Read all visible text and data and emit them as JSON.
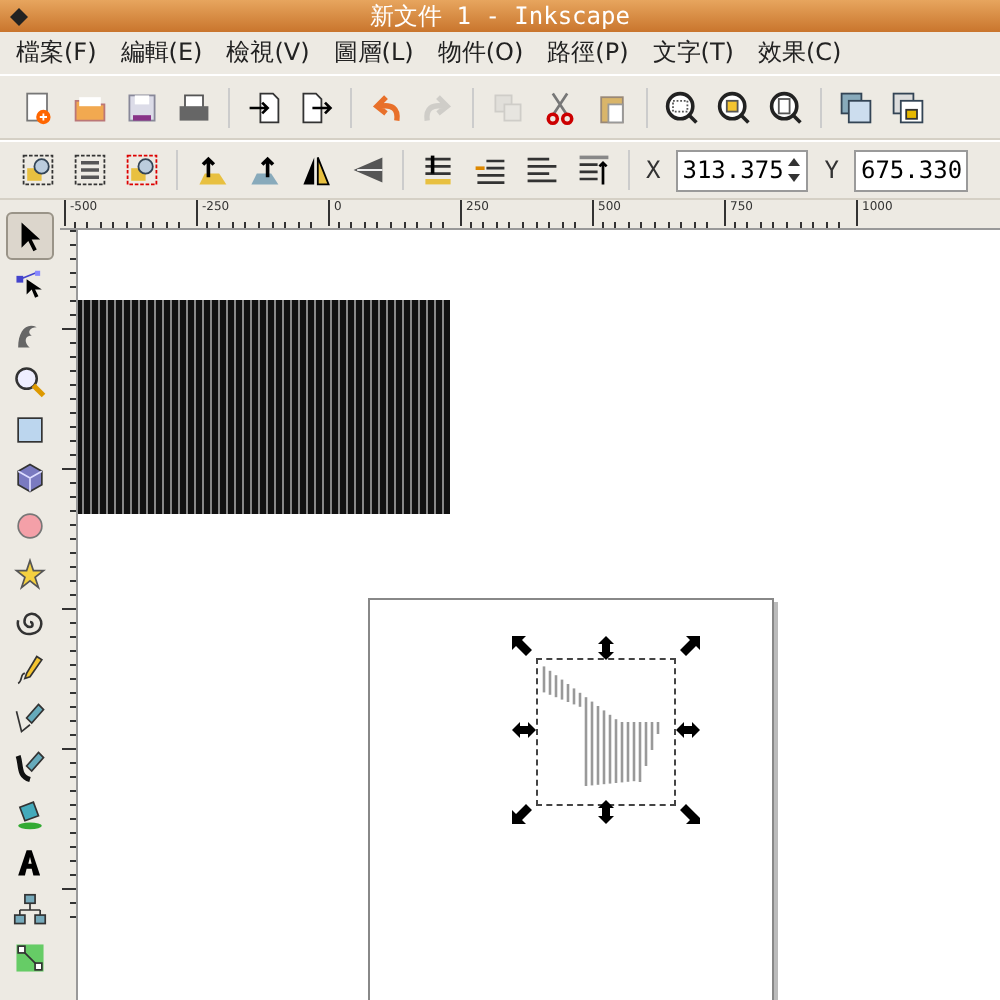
{
  "window": {
    "title": "新文件 1 - Inkscape"
  },
  "menu": [
    "檔案(F)",
    "編輯(E)",
    "檢視(V)",
    "圖層(L)",
    "物件(O)",
    "路徑(P)",
    "文字(T)",
    "效果(C)"
  ],
  "commands_bar": [
    {
      "kind": "new",
      "disabled": false
    },
    {
      "kind": "open",
      "disabled": false
    },
    {
      "kind": "save",
      "disabled": false
    },
    {
      "kind": "print",
      "disabled": false
    },
    {
      "kind": "sep"
    },
    {
      "kind": "import",
      "disabled": false
    },
    {
      "kind": "export",
      "disabled": false
    },
    {
      "kind": "sep"
    },
    {
      "kind": "undo",
      "disabled": false
    },
    {
      "kind": "redo",
      "disabled": true
    },
    {
      "kind": "sep"
    },
    {
      "kind": "duplicate",
      "disabled": true
    },
    {
      "kind": "cut",
      "disabled": false
    },
    {
      "kind": "paste",
      "disabled": false
    },
    {
      "kind": "sep"
    },
    {
      "kind": "zoom-sel",
      "disabled": false
    },
    {
      "kind": "zoom-draw",
      "disabled": false
    },
    {
      "kind": "zoom-page",
      "disabled": false
    },
    {
      "kind": "sep"
    },
    {
      "kind": "copy",
      "disabled": false
    },
    {
      "kind": "lock",
      "disabled": false
    }
  ],
  "select_bar": {
    "tools": [
      {
        "kind": "sel-all"
      },
      {
        "kind": "sel-all-layers"
      },
      {
        "kind": "deselect"
      },
      {
        "kind": "sep"
      },
      {
        "kind": "rot-ccw"
      },
      {
        "kind": "rot-cw"
      },
      {
        "kind": "flip-h"
      },
      {
        "kind": "flip-v"
      },
      {
        "kind": "sep"
      },
      {
        "kind": "bottom"
      },
      {
        "kind": "lower"
      },
      {
        "kind": "raise"
      },
      {
        "kind": "top"
      }
    ],
    "x_label": "X",
    "x_value": "313.375",
    "y_label": "Y",
    "y_value": "675.330"
  },
  "ruler": {
    "labels": [
      "-500",
      "-250",
      "0",
      "250",
      "500",
      "750",
      "1000"
    ]
  },
  "toolbox": [
    {
      "kind": "select",
      "selected": true
    },
    {
      "kind": "node",
      "selected": false
    },
    {
      "kind": "tweak",
      "selected": false
    },
    {
      "kind": "zoom",
      "selected": false
    },
    {
      "kind": "rect",
      "selected": false
    },
    {
      "kind": "box3d",
      "selected": false
    },
    {
      "kind": "ellipse",
      "selected": false
    },
    {
      "kind": "star",
      "selected": false
    },
    {
      "kind": "spiral",
      "selected": false
    },
    {
      "kind": "pencil",
      "selected": false
    },
    {
      "kind": "pen",
      "selected": false
    },
    {
      "kind": "calligraphy",
      "selected": false
    },
    {
      "kind": "bucket",
      "selected": false
    },
    {
      "kind": "text",
      "selected": false
    },
    {
      "kind": "connector",
      "selected": false
    },
    {
      "kind": "gradient",
      "selected": false
    }
  ]
}
